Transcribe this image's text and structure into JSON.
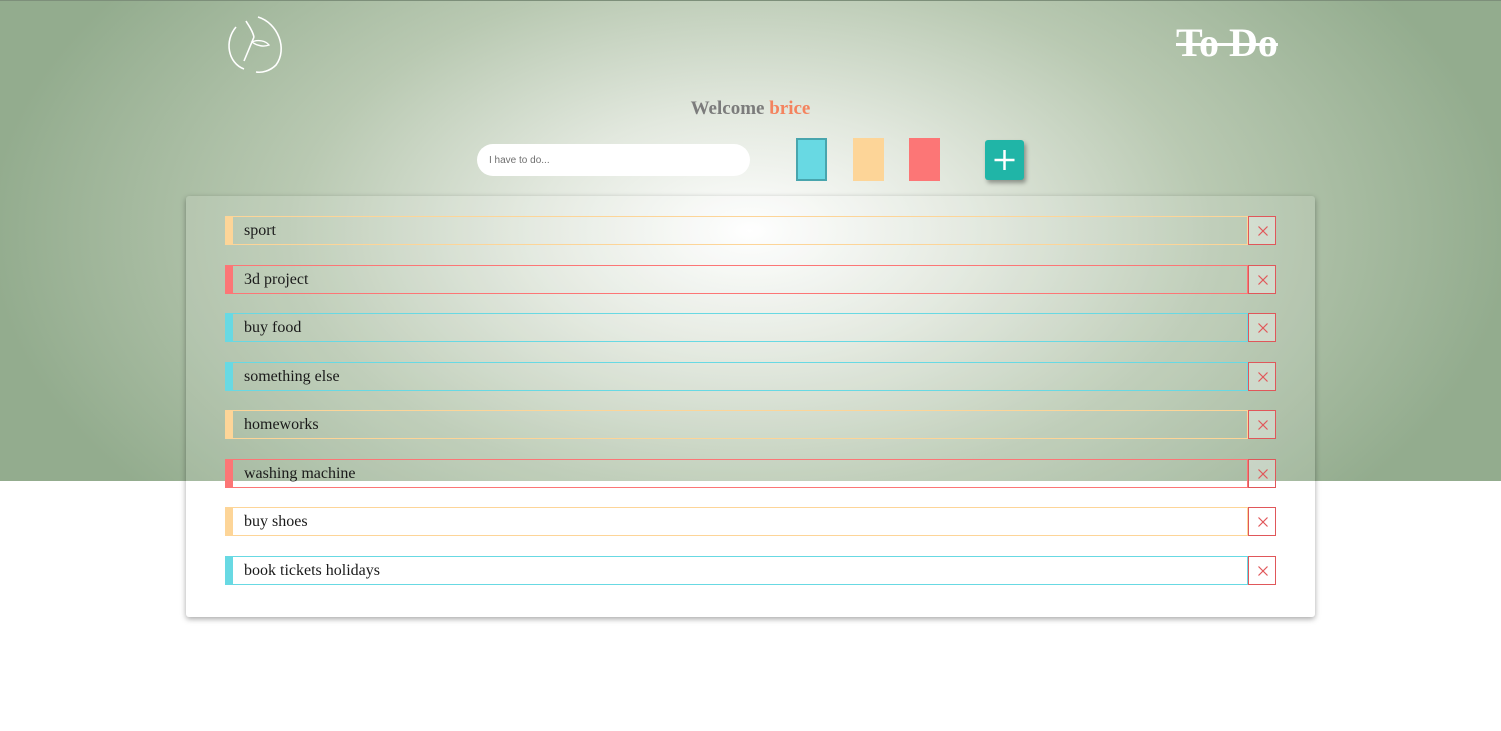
{
  "header": {
    "logo_icon": "leaf-sprout-icon",
    "brand": "To Do"
  },
  "welcome": {
    "greeting": "Welcome",
    "user": "brice"
  },
  "composer": {
    "placeholder": "I have to do...",
    "value": "",
    "colors": [
      {
        "name": "blue",
        "hex": "#68d9e3",
        "selected": true
      },
      {
        "name": "yellow",
        "hex": "#fdd598",
        "selected": false
      },
      {
        "name": "red",
        "hex": "#fc7676",
        "selected": false
      }
    ],
    "add_icon": "plus-icon",
    "add_color": "#20b5a7"
  },
  "tasks": [
    {
      "text": "sport",
      "color": "yellow"
    },
    {
      "text": "3d project",
      "color": "red"
    },
    {
      "text": "buy food",
      "color": "blue"
    },
    {
      "text": "something else",
      "color": "blue"
    },
    {
      "text": "homeworks",
      "color": "yellow"
    },
    {
      "text": "washing machine",
      "color": "red"
    },
    {
      "text": "buy shoes",
      "color": "yellow"
    },
    {
      "text": "book tickets holidays",
      "color": "blue"
    }
  ],
  "delete_icon": "close-icon",
  "delete_color": "#e0575a"
}
